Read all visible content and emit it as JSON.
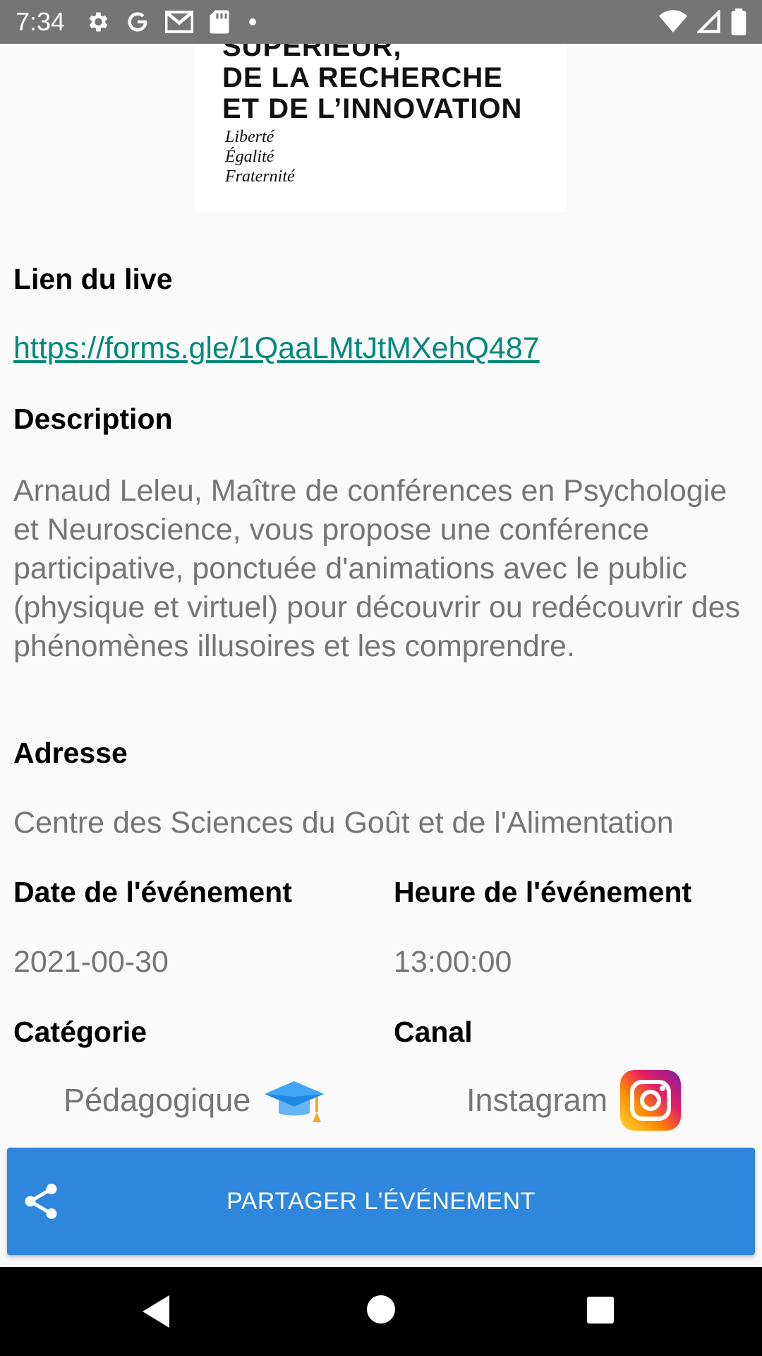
{
  "status_bar": {
    "time": "7:34",
    "left_icons": [
      "settings-icon",
      "google-icon",
      "gmail-icon",
      "sd-card-icon",
      "notification-dot-icon"
    ],
    "right_icons": [
      "wifi-icon",
      "signal-icon",
      "battery-icon"
    ]
  },
  "logo": {
    "lines": [
      "SUPÉRIEUR,",
      "DE LA RECHERCHE",
      "ET DE L’INNOVATION"
    ],
    "motto": [
      "Liberté",
      "Égalité",
      "Fraternité"
    ]
  },
  "live": {
    "label": "Lien du live",
    "url": "https://forms.gle/1QaaLMtJtMXehQ487"
  },
  "description": {
    "label": "Description",
    "text": "Arnaud Leleu, Maître de conférences en Psychologie et Neuroscience, vous propose une conférence participative, ponctuée d'animations avec le public (physique et virtuel) pour découvrir ou redécouvrir des phénomènes illusoires et les comprendre."
  },
  "address": {
    "label": "Adresse",
    "value": "Centre des Sciences du Goût et de l'Alimentation"
  },
  "date": {
    "label": "Date de l'événement",
    "value": "2021-00-30"
  },
  "time": {
    "label": "Heure de l'événement",
    "value": "13:00:00"
  },
  "category": {
    "label": "Catégorie",
    "value": "Pédagogique",
    "icon": "graduation-cap-icon"
  },
  "channel": {
    "label": "Canal",
    "value": "Instagram",
    "icon": "instagram-icon"
  },
  "share_button": {
    "label": "PARTAGER L'ÉVÉNEMENT",
    "icon": "share-icon"
  },
  "nav": [
    "back-icon",
    "home-icon",
    "recents-icon"
  ],
  "colors": {
    "status_bar": "#757575",
    "link": "#00897b",
    "button": "#2f86dd",
    "muted_text": "#757575"
  }
}
